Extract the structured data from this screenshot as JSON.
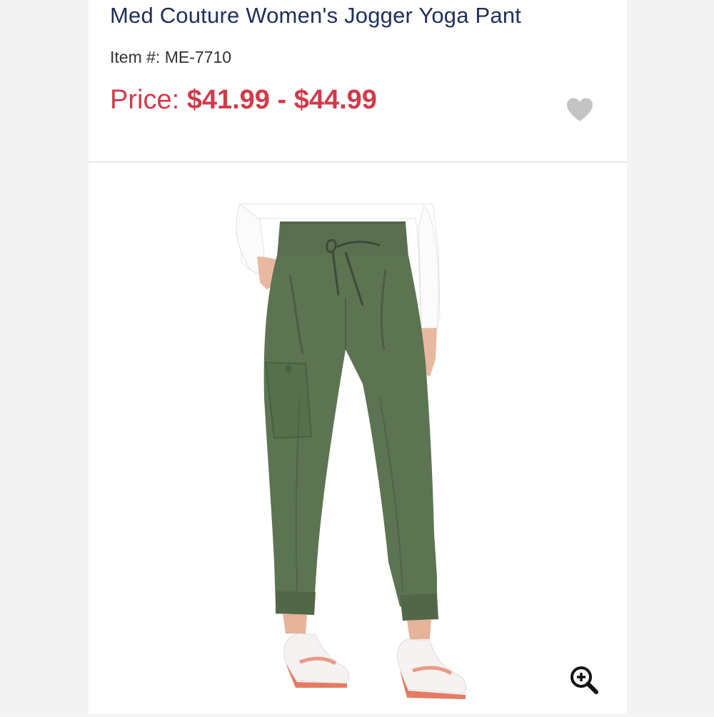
{
  "product": {
    "title": "Med Couture Women's Jogger Yoga Pant",
    "item_label": "Item #: ",
    "item_number": "ME-7710",
    "price_label": "Price: ",
    "price_range": "$41.99 - $44.99"
  },
  "colors": {
    "title": "#1f2f5c",
    "price": "#d23a4a",
    "pant": "#5c7452",
    "heart": "#c4c4c4"
  },
  "icons": {
    "favorite": "heart-icon",
    "zoom": "zoom-in-icon"
  }
}
